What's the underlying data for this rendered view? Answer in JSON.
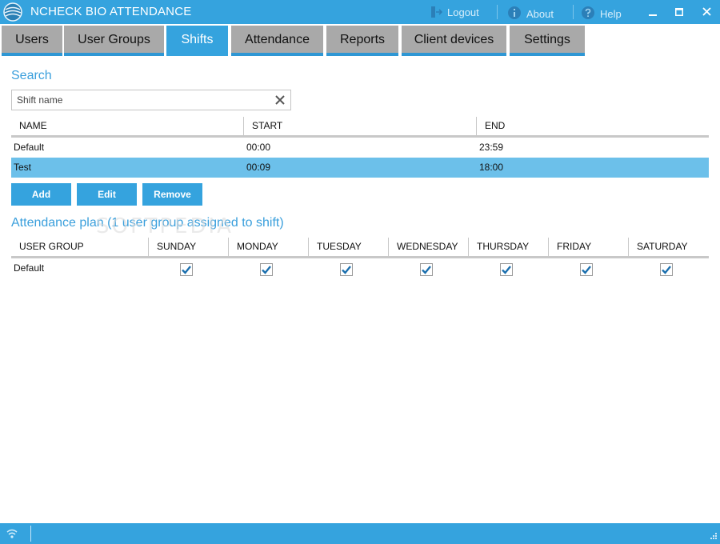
{
  "app": {
    "title": "NCHECK BIO ATTENDANCE",
    "actions": {
      "logout": "Logout",
      "about": "About",
      "help": "Help"
    }
  },
  "tabs": [
    {
      "label": "Users"
    },
    {
      "label": "User Groups"
    },
    {
      "label": "Shifts",
      "active": true
    },
    {
      "label": "Attendance"
    },
    {
      "label": "Reports"
    },
    {
      "label": "Client devices"
    },
    {
      "label": "Settings"
    }
  ],
  "search": {
    "title": "Search",
    "placeholder": "Shift name",
    "value": ""
  },
  "shifts_table": {
    "columns": [
      "NAME",
      "START",
      "END"
    ],
    "rows": [
      {
        "name": "Default",
        "start": "00:00",
        "end": "23:59",
        "selected": false
      },
      {
        "name": "Test",
        "start": "00:09",
        "end": "18:00",
        "selected": true
      }
    ]
  },
  "buttons": {
    "add": "Add",
    "edit": "Edit",
    "remove": "Remove"
  },
  "attendance_plan": {
    "title": "Attendance plan (1 user group assigned to shift)",
    "columns": [
      "USER GROUP",
      "SUNDAY",
      "MONDAY",
      "TUESDAY",
      "WEDNESDAY",
      "THURSDAY",
      "FRIDAY",
      "SATURDAY"
    ],
    "rows": [
      {
        "group": "Default",
        "days": [
          true,
          true,
          true,
          true,
          true,
          true,
          true
        ]
      }
    ]
  },
  "watermark": "SOFTPEDIA",
  "colors": {
    "accent": "#35a3de",
    "selected_row": "#6cc0ea",
    "tab_inactive": "#a9a9a9",
    "check": "#1b6fae"
  }
}
